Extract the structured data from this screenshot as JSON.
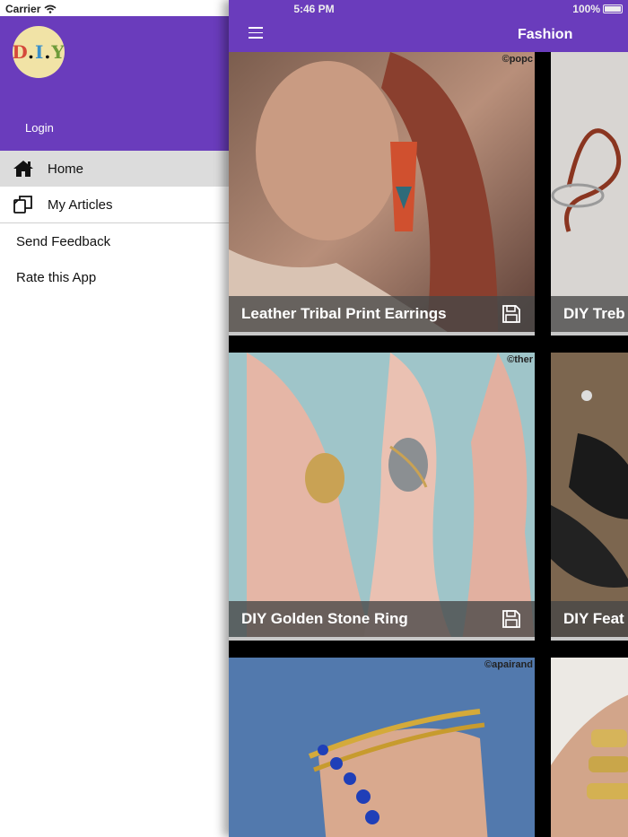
{
  "status_bar": {
    "carrier": "Carrier",
    "time": "5:46 PM",
    "battery": "100%"
  },
  "drawer": {
    "logo_text": "DIY",
    "login_label": "Login",
    "menu": [
      {
        "label": "Home",
        "icon": "home-icon",
        "active": true
      },
      {
        "label": "My Articles",
        "icon": "articles-icon",
        "active": false
      },
      {
        "label": "Send Feedback",
        "icon": "",
        "active": false
      },
      {
        "label": "Rate this App",
        "icon": "",
        "active": false
      }
    ]
  },
  "header": {
    "title": "Fashion"
  },
  "cards": [
    {
      "caption": "Leather Tribal Print Earrings",
      "copyright": "©popc"
    },
    {
      "caption": "DIY Treb",
      "copyright": ""
    },
    {
      "caption": "DIY Golden Stone Ring",
      "copyright": "©ther"
    },
    {
      "caption": "DIY Feat",
      "copyright": ""
    },
    {
      "caption": "",
      "copyright": "©apairand"
    },
    {
      "caption": "",
      "copyright": ""
    }
  ],
  "colors": {
    "accent": "#6a3cbc",
    "active_menu_bg": "#dcdcdc",
    "caption_bg": "#464646"
  }
}
